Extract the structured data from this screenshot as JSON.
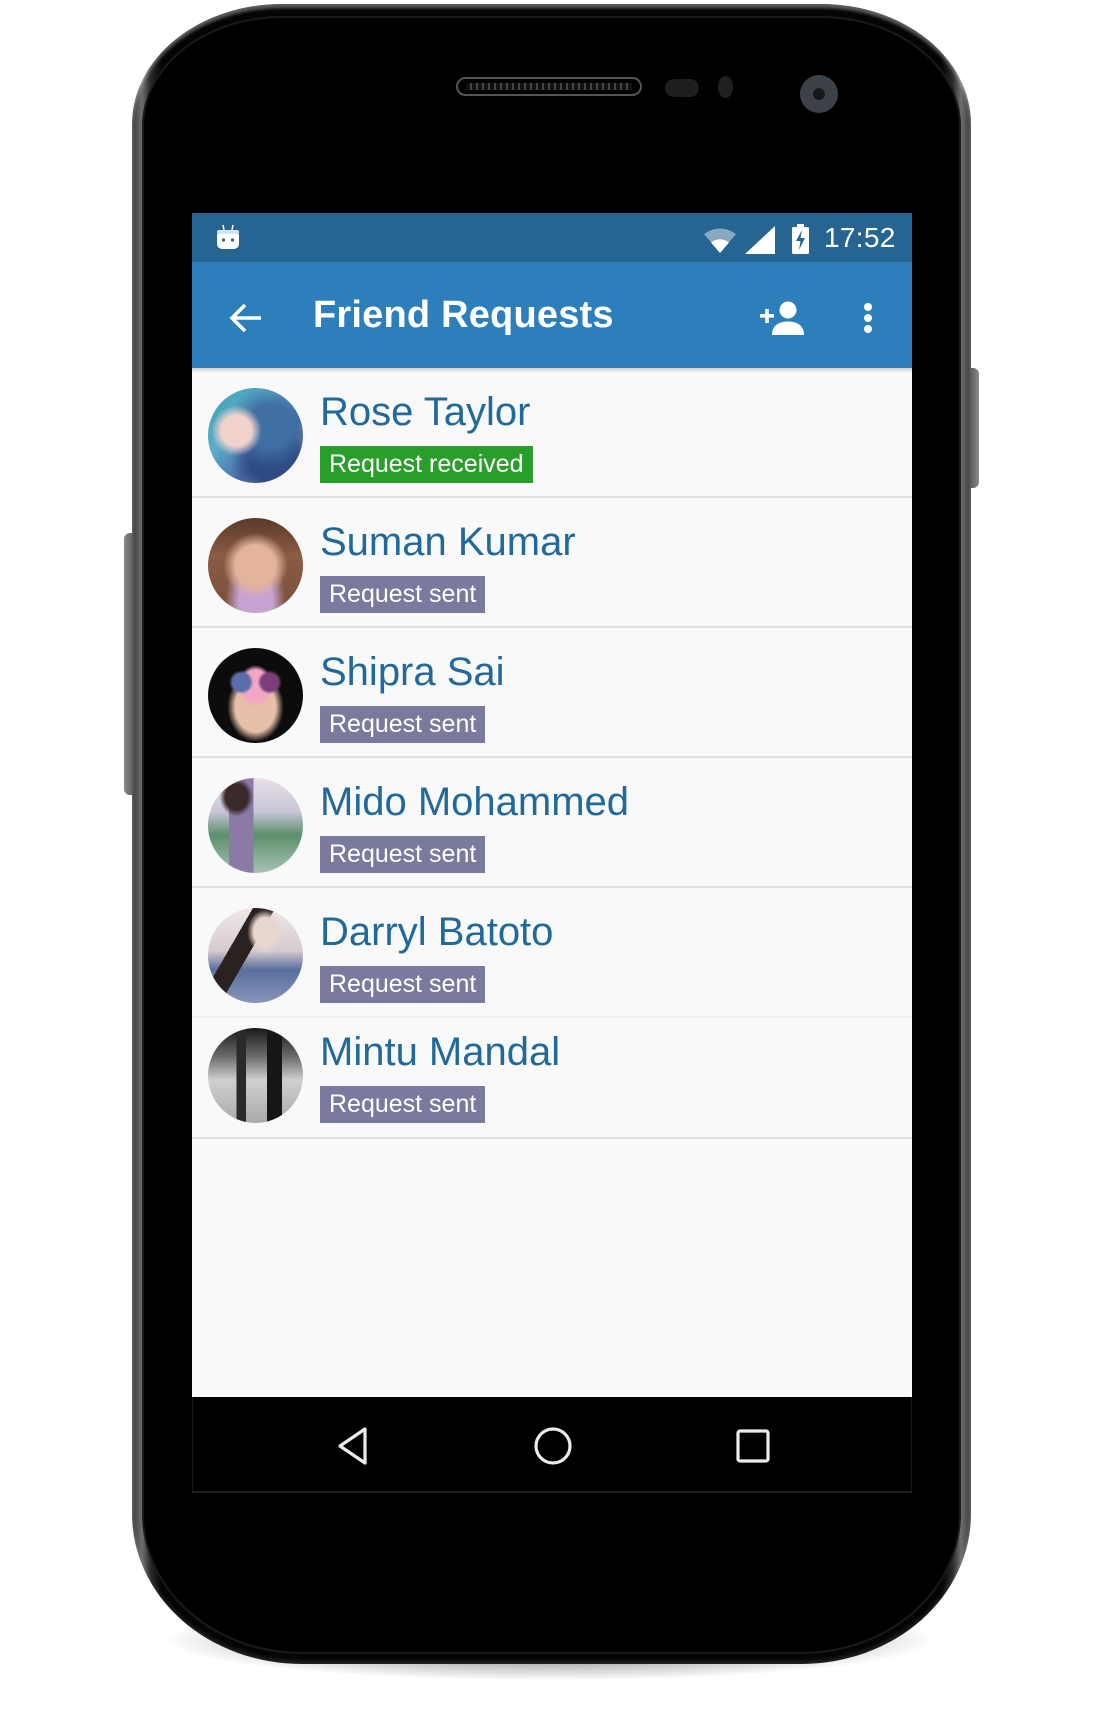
{
  "status_bar": {
    "notification_icon": "android-debug-icon",
    "wifi_icon": "wifi-icon",
    "signal_icon": "cell-signal-icon",
    "battery_icon": "battery-charging-icon",
    "time": "17:52"
  },
  "app_bar": {
    "back_icon": "arrow-back-icon",
    "title": "Friend Requests",
    "add_friend_icon": "person-add-icon",
    "overflow_icon": "more-vert-icon",
    "background_color": "#2c7fbb",
    "status_bar_color": "#266592"
  },
  "friend_requests": [
    {
      "name": "Rose Taylor",
      "status": "Request received",
      "status_color": "#2a9e2a"
    },
    {
      "name": "Suman Kumar",
      "status": "Request sent",
      "status_color": "#7a7a9e"
    },
    {
      "name": "Shipra Sai",
      "status": "Request sent",
      "status_color": "#7a7a9e"
    },
    {
      "name": "Mido Mohammed",
      "status": "Request sent",
      "status_color": "#7a7a9e"
    },
    {
      "name": "Darryl Batoto",
      "status": "Request sent",
      "status_color": "#7a7a9e"
    },
    {
      "name": "Mintu Mandal",
      "status": "Request sent",
      "status_color": "#7a7a9e"
    }
  ],
  "nav_bar": {
    "back_icon": "nav-back-icon",
    "home_icon": "nav-home-icon",
    "recents_icon": "nav-recents-icon"
  },
  "colors": {
    "name_text": "#21699a",
    "list_background": "#f9f9f9"
  }
}
